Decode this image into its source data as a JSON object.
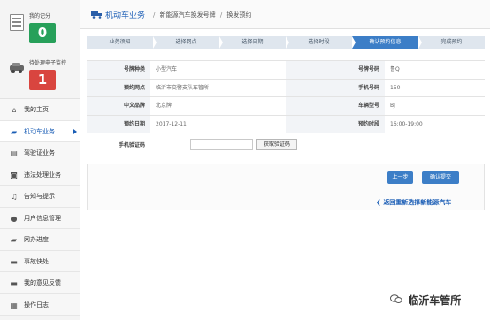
{
  "sidebar": {
    "score_label": "我的记分",
    "score_value": "0",
    "pending_label": "待处理电子监控",
    "pending_value": "1",
    "nav": [
      {
        "label": "我的主页"
      },
      {
        "label": "机动车业务"
      },
      {
        "label": "驾驶证业务"
      },
      {
        "label": "违法处理业务"
      },
      {
        "label": "告知与提示"
      },
      {
        "label": "用户信息管理"
      },
      {
        "label": "网办进度"
      },
      {
        "label": "事故快处"
      },
      {
        "label": "我的意见反馈"
      },
      {
        "label": "操作日志"
      }
    ]
  },
  "header": {
    "title": "机动车业务",
    "breadcrumb_1": "新能源汽车换发号牌",
    "breadcrumb_2": "换发预约"
  },
  "steps": [
    {
      "label": "业务须知"
    },
    {
      "label": "选择网点"
    },
    {
      "label": "选择日期"
    },
    {
      "label": "选择时段"
    },
    {
      "label": "确认预约信息"
    },
    {
      "label": "完成预约"
    }
  ],
  "info": {
    "plate_type_label": "号牌种类",
    "plate_type_value": "小型汽车",
    "plate_no_label": "号牌号码",
    "plate_no_value": "鲁Q",
    "branch_label": "预约网点",
    "branch_value": "临沂市交警支队车管所",
    "phone_label": "手机号码",
    "phone_value": "150",
    "brand_label": "中文品牌",
    "brand_value": "北京牌",
    "model_label": "车辆型号",
    "model_value": "BJ",
    "date_label": "预约日期",
    "date_value": "2017-12-11",
    "time_label": "预约时段",
    "time_value": "16:00-19:00",
    "code_label": "手机验证码",
    "code_button": "获取验证码"
  },
  "actions": {
    "prev_label": "上一步",
    "confirm_label": "确认提交",
    "back_link": "返回重新选择新能源汽车"
  },
  "watermark": {
    "label": "临沂车管所"
  }
}
